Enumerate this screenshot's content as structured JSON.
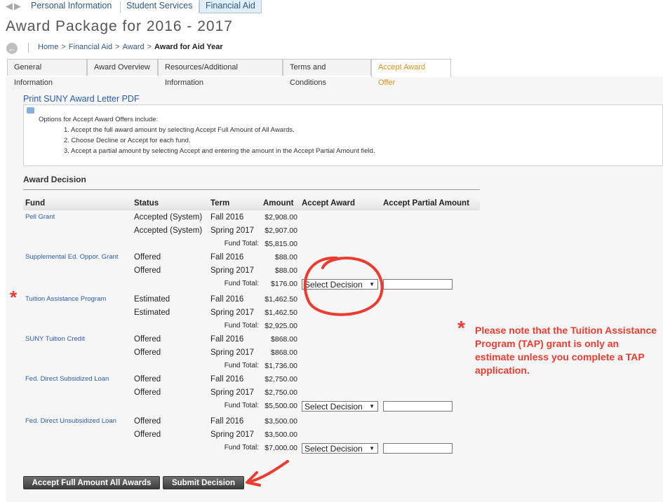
{
  "top_tabs": [
    "Personal Information",
    "Student Services",
    "Financial Aid"
  ],
  "page_title": "Award Package for 2016 - 2017",
  "breadcrumb": {
    "home": "Home",
    "financial_aid": "Financial Aid",
    "award": "Award",
    "current": "Award for Aid Year",
    "sep": ">"
  },
  "page_tabs": [
    "General Information",
    "Award Overview",
    "Resources/Additional Information",
    "Terms and Conditions",
    "Accept Award Offer"
  ],
  "print_link": "Print SUNY Award Letter PDF",
  "info": {
    "intro": "Options for Accept Award Offers include:",
    "lines": [
      "1. Accept the full award amount by selecting Accept Full Amount of All Awards.",
      "2. Choose Decline or Accept for each fund.",
      "3. Accept a partial amount by selecting Accept and entering the amount in the Accept Partial Amount field."
    ]
  },
  "section_title": "Award Decision",
  "table": {
    "headers": [
      "Fund",
      "Status",
      "Term",
      "Amount",
      "Accept Award",
      "Accept Partial Amount"
    ],
    "fund_total_label": "Fund Total:",
    "select_label": "Select Decision",
    "funds": [
      {
        "name": "Pell Grant",
        "rows": [
          [
            "Accepted (System)",
            "Fall 2016",
            "$2,908.00"
          ],
          [
            "Accepted (System)",
            "Spring 2017",
            "$2,907.00"
          ]
        ],
        "total": "$5,815.00"
      },
      {
        "name": "Supplemental Ed. Oppor. Grant",
        "rows": [
          [
            "Offered",
            "Fall 2016",
            "$88.00"
          ],
          [
            "Offered",
            "Spring 2017",
            "$88.00"
          ]
        ],
        "total": "$176.00"
      },
      {
        "name": "Tuition Assistance Program",
        "rows": [
          [
            "Estimated",
            "Fall 2016",
            "$1,462.50"
          ],
          [
            "Estimated",
            "Spring 2017",
            "$1,462.50"
          ]
        ],
        "total": "$2,925.00"
      },
      {
        "name": "SUNY Tuition Credit",
        "rows": [
          [
            "Offered",
            "Fall 2016",
            "$868.00"
          ],
          [
            "Offered",
            "Spring 2017",
            "$868.00"
          ]
        ],
        "total": "$1,736.00"
      },
      {
        "name": "Fed. Direct Subsidized Loan",
        "rows": [
          [
            "Offered",
            "Fall 2016",
            "$2,750.00"
          ],
          [
            "Offered",
            "Spring 2017",
            "$2,750.00"
          ]
        ],
        "total": "$5,500.00"
      },
      {
        "name": "Fed. Direct Unsubsidized Loan",
        "rows": [
          [
            "Offered",
            "Fall 2016",
            "$3,500.00"
          ],
          [
            "Offered",
            "Spring 2017",
            "$3,500.00"
          ]
        ],
        "total": "$7,000.00"
      }
    ]
  },
  "buttons": {
    "accept_full": "Accept Full Amount All Awards",
    "submit": "Submit Decision"
  },
  "note": {
    "star": "*",
    "text": "Please note that the Tuition Assistance Program (TAP) grant is only an estimate unless you complete a TAP application."
  },
  "colors": {
    "annotation_red": "#ec3c2f",
    "link_blue": "#2a5bb0",
    "active_tab_orange": "#e0901d"
  }
}
